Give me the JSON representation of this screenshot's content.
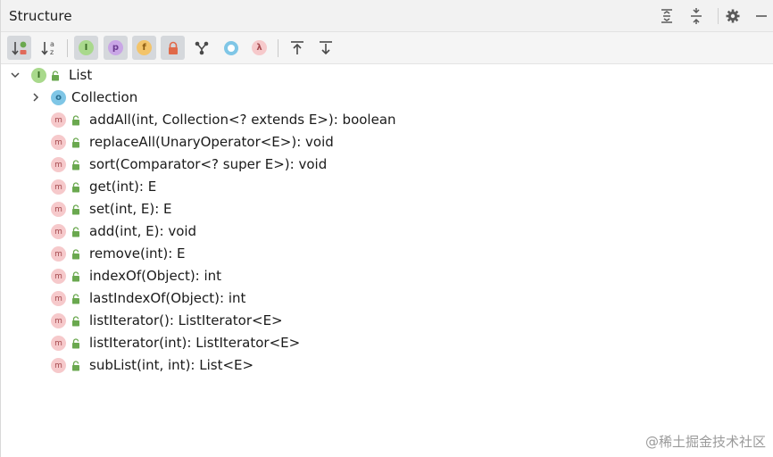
{
  "header": {
    "title": "Structure"
  },
  "toolbar": {
    "badges": {
      "interface_letter": "I",
      "property_letter": "p",
      "field_letter": "f",
      "lambda_letter": "λ"
    },
    "sort_alpha_letters": "a z"
  },
  "tree": {
    "root": {
      "icon_letter": "I",
      "label": "List"
    },
    "collection": {
      "icon_letter": "o",
      "label": "Collection"
    },
    "method_icon_letter": "m",
    "methods": [
      "addAll(int, Collection<? extends E>): boolean",
      "replaceAll(UnaryOperator<E>): void",
      "sort(Comparator<? super E>): void",
      "get(int): E",
      "set(int, E): E",
      "add(int, E): void",
      "remove(int): E",
      "indexOf(Object): int",
      "lastIndexOf(Object): int",
      "listIterator(): ListIterator<E>",
      "listIterator(int): ListIterator<E>",
      "subList(int, int): List<E>"
    ]
  },
  "watermark": "@稀土掘金技术社区",
  "colors": {
    "method_badge": "#f6c9cb",
    "interface_badge": "#a9d98c",
    "class_badge": "#7fc6e6",
    "lock_green": "#6aa84f"
  }
}
